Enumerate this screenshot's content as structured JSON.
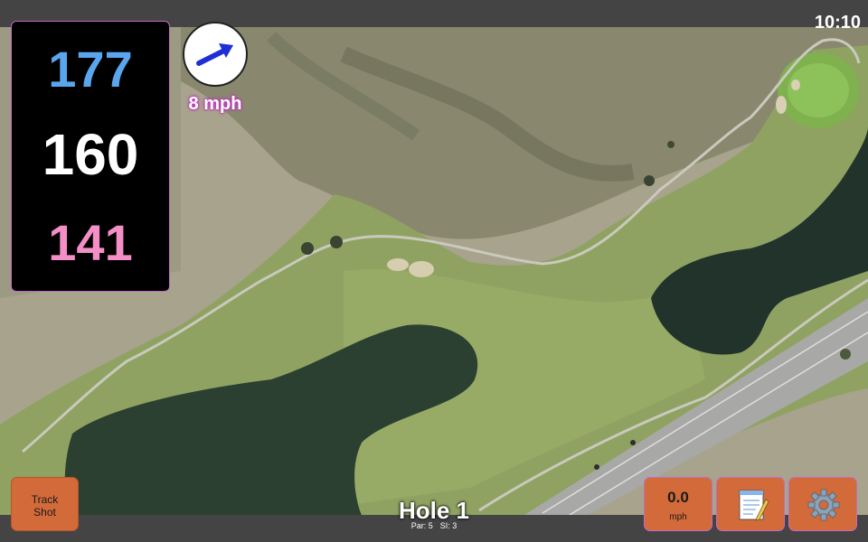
{
  "status_bar": {
    "time": "10:10"
  },
  "distances": {
    "back": "177",
    "middle": "160",
    "front": "141"
  },
  "wind": {
    "speed_label": "8 mph",
    "icon": "arrow-icon"
  },
  "buttons": {
    "track_shot_line1": "Track",
    "track_shot_line2": "Shot",
    "speed_value": "0.0",
    "speed_unit": "mph",
    "notes_icon": "notepad-icon",
    "settings_icon": "gear-icon"
  },
  "hole": {
    "title": "Hole 1",
    "par": "Par: 5",
    "si": "SI: 3"
  },
  "colors": {
    "back": "#5aa6ee",
    "middle": "#ffffff",
    "front": "#f38fc6",
    "button": "#d36a3a"
  }
}
